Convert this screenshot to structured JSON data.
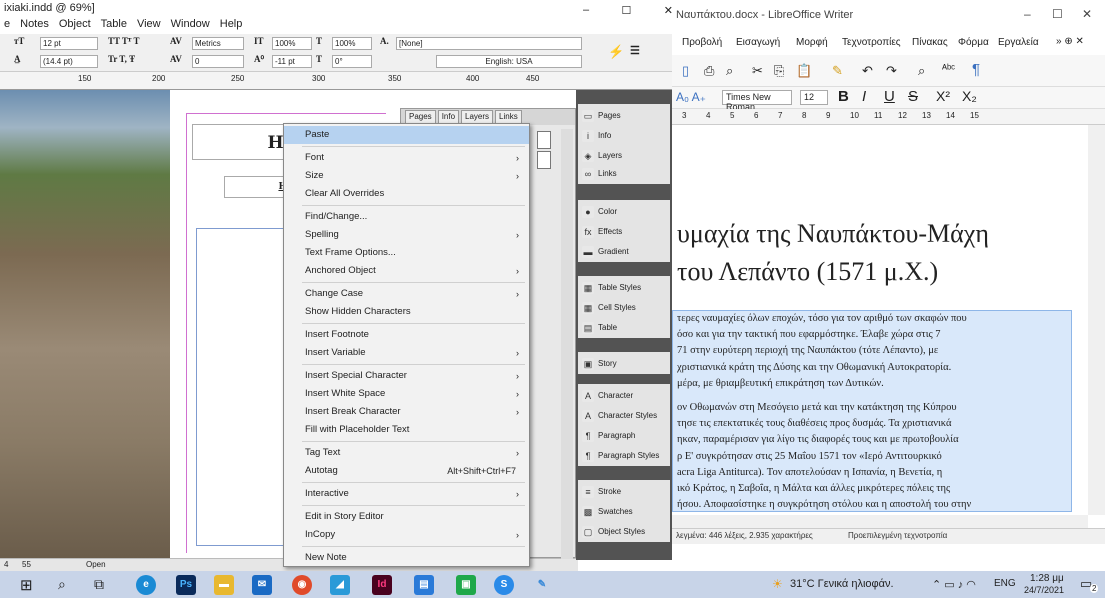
{
  "indesign": {
    "title": "ixiaki.indd @ 69%]",
    "window_controls": [
      "–",
      "☐",
      "✕"
    ],
    "menu": [
      "e",
      "Notes",
      "Object",
      "Table",
      "View",
      "Window",
      "Help"
    ],
    "ctrl": {
      "font_size": "12 pt",
      "leading": "(14.4 pt)",
      "kerning": "Metrics",
      "tracking": "0",
      "scale_v": "100%",
      "scale_h": "100%",
      "baseline": "-11 pt",
      "skew": "0°",
      "char_style": "[None]",
      "language": "English: USA"
    },
    "ruler_ticks": [
      "150",
      "200",
      "250",
      "300",
      "350",
      "400",
      "450"
    ],
    "title_frame": "Η Ν",
    "sub_frame": "Η πόλ",
    "status": {
      "page": "4",
      "zoom": "55",
      "open": "Open"
    }
  },
  "pages_panel": {
    "tabs": [
      "Pages",
      "Info",
      "Layers",
      "Links"
    ]
  },
  "dock": {
    "group1": [
      {
        "label": "Pages",
        "icon": "pages-icon"
      },
      {
        "label": "Info",
        "icon": "info-icon"
      },
      {
        "label": "Layers",
        "icon": "layers-icon"
      },
      {
        "label": "Links",
        "icon": "links-icon"
      }
    ],
    "group2": [
      {
        "label": "Color",
        "icon": "color-icon"
      },
      {
        "label": "Effects",
        "icon": "effects-icon"
      },
      {
        "label": "Gradient",
        "icon": "gradient-icon"
      }
    ],
    "group3": [
      {
        "label": "Table Styles",
        "icon": "table-styles-icon"
      },
      {
        "label": "Cell Styles",
        "icon": "cell-styles-icon"
      },
      {
        "label": "Table",
        "icon": "table-icon"
      }
    ],
    "group4": [
      {
        "label": "Story",
        "icon": "story-icon"
      }
    ],
    "group5": [
      {
        "label": "Character",
        "icon": "character-icon"
      },
      {
        "label": "Character Styles",
        "icon": "character-styles-icon"
      },
      {
        "label": "Paragraph",
        "icon": "paragraph-icon"
      },
      {
        "label": "Paragraph Styles",
        "icon": "paragraph-styles-icon"
      }
    ],
    "group6": [
      {
        "label": "Stroke",
        "icon": "stroke-icon"
      },
      {
        "label": "Swatches",
        "icon": "swatches-icon"
      },
      {
        "label": "Object Styles",
        "icon": "object-styles-icon"
      }
    ]
  },
  "context_menu": {
    "items": [
      {
        "label": "Paste",
        "arrow": false
      },
      {
        "label": "Font",
        "arrow": true
      },
      {
        "label": "Size",
        "arrow": true
      },
      {
        "label": "Clear All Overrides",
        "arrow": false
      },
      {
        "label": "Find/Change...",
        "arrow": false
      },
      {
        "label": "Spelling",
        "arrow": true
      },
      {
        "label": "Text Frame Options...",
        "arrow": false
      },
      {
        "label": "Anchored Object",
        "arrow": true
      },
      {
        "label": "Change Case",
        "arrow": true
      },
      {
        "label": "Show Hidden Characters",
        "arrow": false
      },
      {
        "label": "Insert Footnote",
        "arrow": false
      },
      {
        "label": "Insert Variable",
        "arrow": true
      },
      {
        "label": "Insert Special Character",
        "arrow": true
      },
      {
        "label": "Insert White Space",
        "arrow": true
      },
      {
        "label": "Insert Break Character",
        "arrow": true
      },
      {
        "label": "Fill with Placeholder Text",
        "arrow": false
      },
      {
        "label": "Tag Text",
        "arrow": true
      },
      {
        "label": "Autotag",
        "shortcut": "Alt+Shift+Ctrl+F7"
      },
      {
        "label": "Interactive",
        "arrow": true
      },
      {
        "label": "Edit in Story Editor",
        "arrow": false
      },
      {
        "label": "InCopy",
        "arrow": true
      },
      {
        "label": "New Note",
        "arrow": false
      }
    ]
  },
  "libreoffice": {
    "title": "Ναυπάκτου.docx - LibreOffice Writer",
    "menu": [
      "Προβολή",
      "Εισαγωγή",
      "Μορφή",
      "Τεχνοτροπίες",
      "Πίνακας",
      "Φόρμα",
      "Εργαλεία"
    ],
    "font_name": "Times New Roman",
    "font_size": "12",
    "ruler_ticks": [
      "3",
      "4",
      "5",
      "6",
      "7",
      "8",
      "9",
      "10",
      "11",
      "12",
      "13",
      "14",
      "15"
    ],
    "heading_line1": "υμαχία της Ναυπάκτου-Μάχη",
    "heading_line2": "του Λεπάντο (1571 μ.Χ.)",
    "para1": [
      "τερες ναυμαχίες όλων εποχών, τόσο για τον αριθμό των σκαφών που",
      "όσο και για την τακτική που εφαρμόστηκε. Έλαβε χώρα στις 7",
      "71 στην ευρύτερη περιοχή της Ναυπάκτου (τότε Λέπαντο), με",
      "χριστιανικά κράτη της Δύσης και την Οθωμανική Αυτοκρατορία.",
      "μέρα, με θριαμβευτική επικράτηση των Δυτικών."
    ],
    "para2": [
      "ον Οθωμανών στη Μεσόγειο μετά και την κατάκτηση της Κύπρου",
      "τησε τις επεκτατικές τους διαθέσεις προς δυσμάς. Τα χριστιανικά",
      "ηκαν, παραμέρισαν για λίγο τις διαφορές τους και με πρωτοβουλία",
      "ρ Ε' συγκρότησαν στις 25 Μαΐου 1571 τον «Ιερό Αντιτουρκικό",
      "acra Liga Antiturca). Τον αποτελούσαν η Ισπανία, η Βενετία, η",
      "ικό Κράτος, η Σαβοΐα, η Μάλτα και άλλες μικρότερες πόλεις της",
      "ήσου. Αποφασίστηκε η συγκρότηση στόλου και η αποστολή του στην"
    ],
    "status": "λεγμένα: 446 λέξεις, 2.935 χαρακτήρες",
    "status2": "Προεπιλεγμένη τεχνοτροπία"
  },
  "taskbar": {
    "weather": "31°C Γενικά ηλιοφάν.",
    "lang": "ENG",
    "time": "1:28 μμ",
    "date": "24/7/2021",
    "notif": "2"
  }
}
